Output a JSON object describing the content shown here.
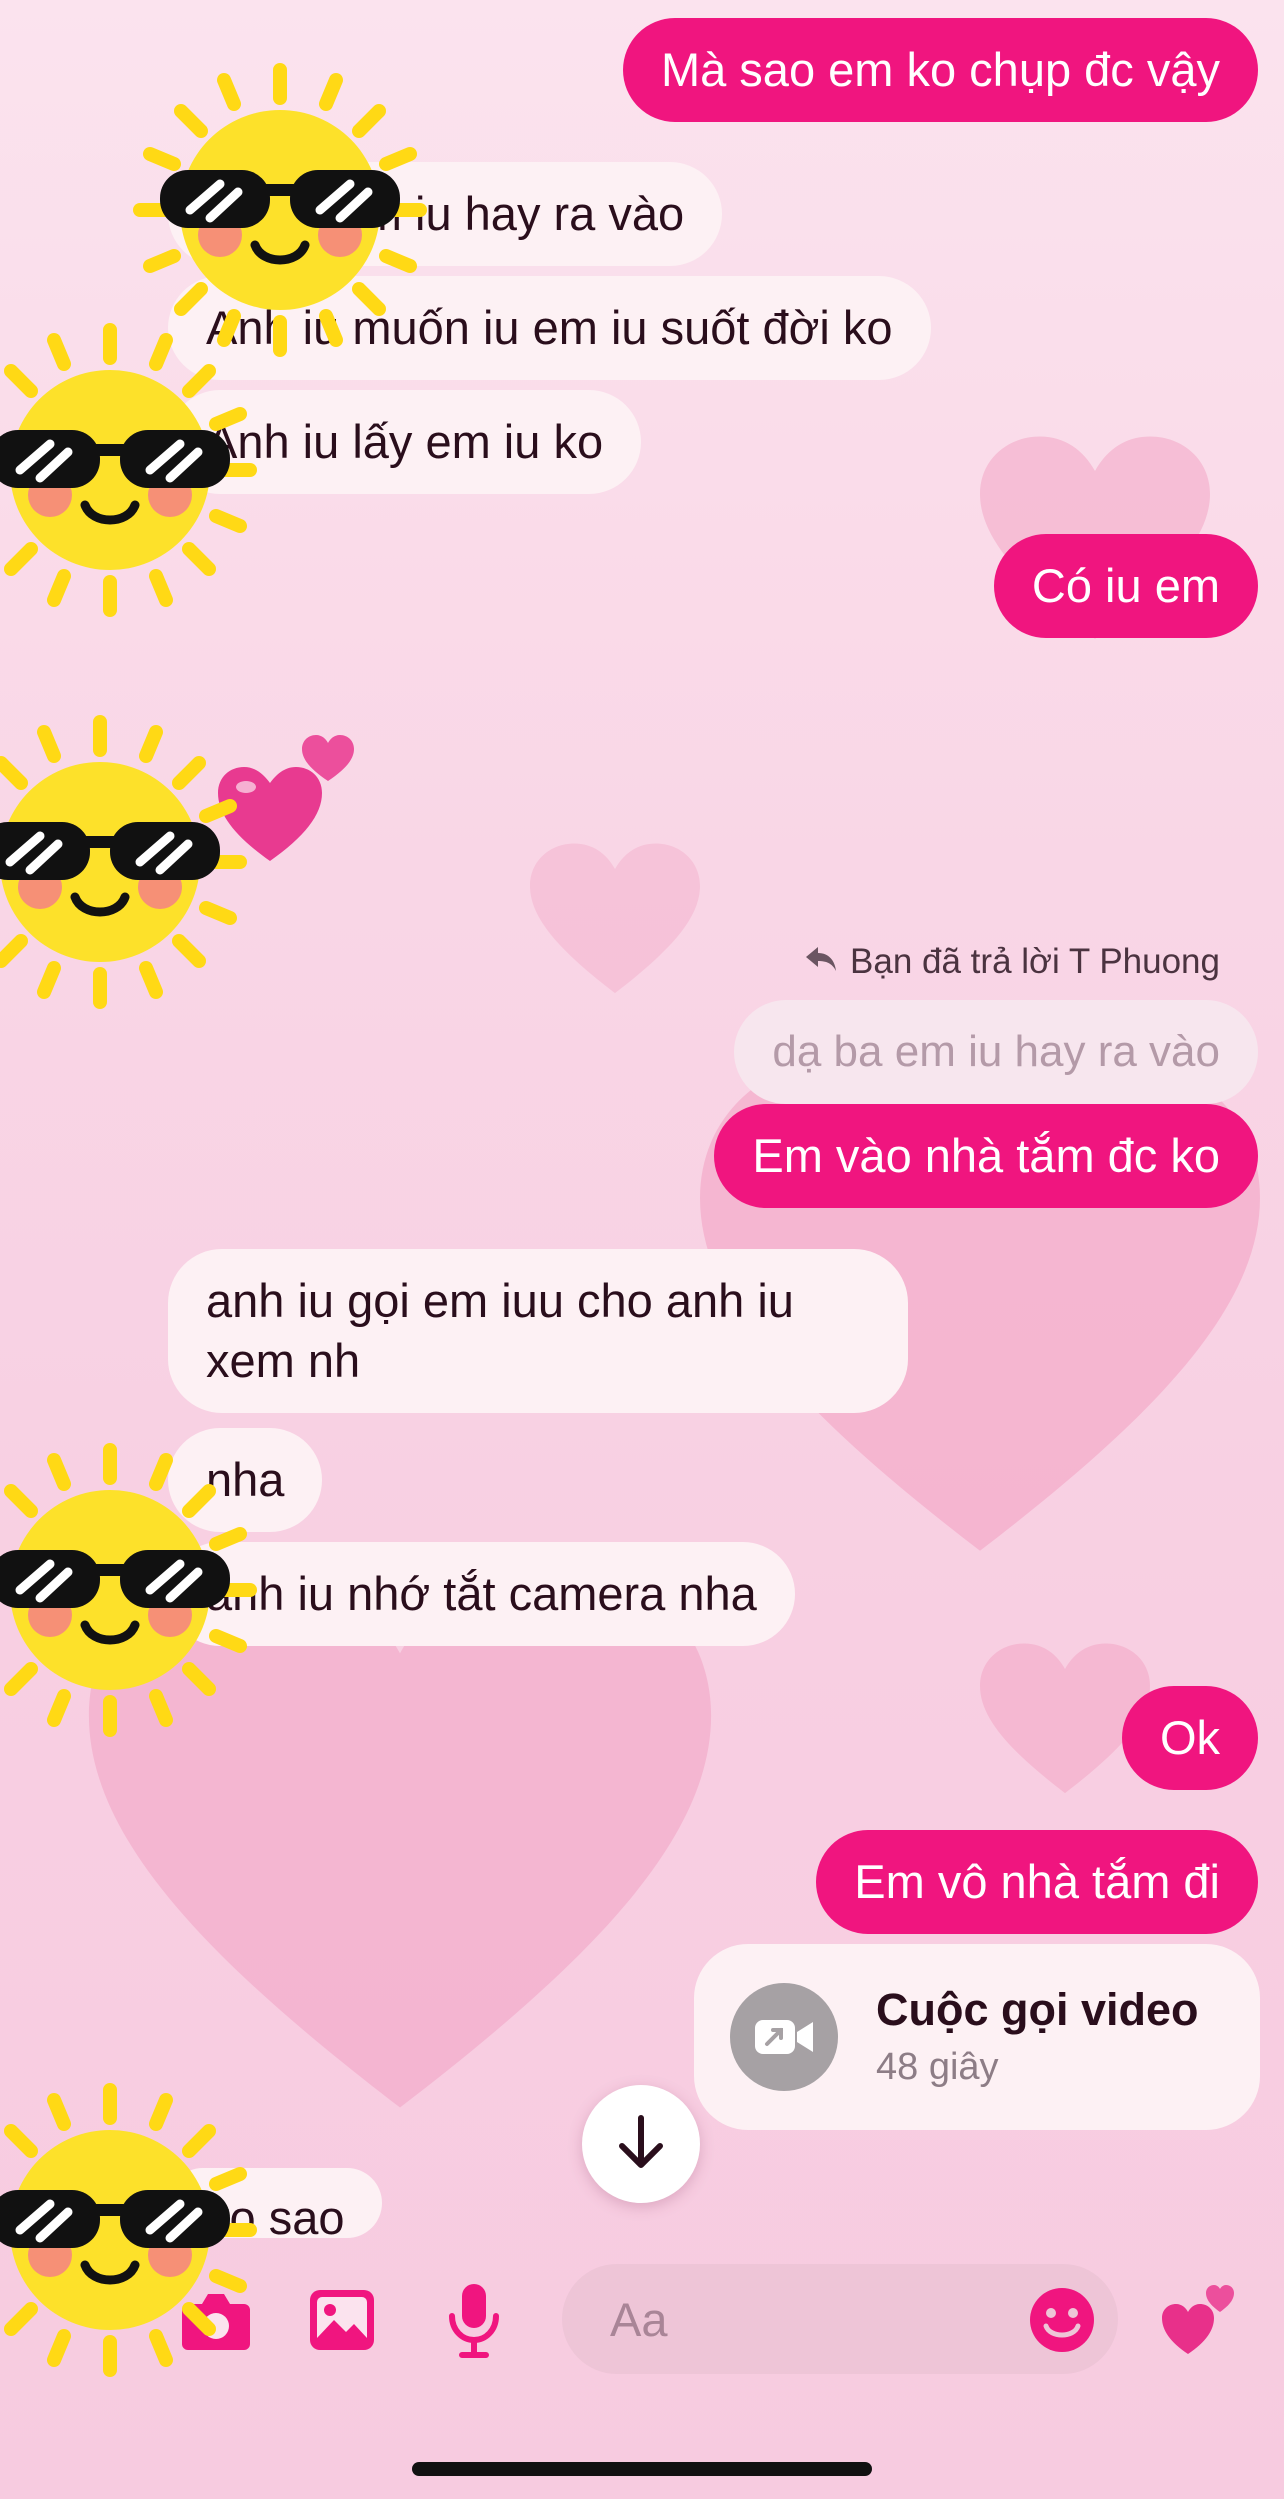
{
  "messages": {
    "out_1": "Mà sao em ko chụp đc vậy",
    "in_1": "dạ ba em iu hay ra vào",
    "in_2": "Anh iu muốn iu em iu suốt đời ko",
    "in_3": "Anh iu lấy em iu ko",
    "out_2": "Có iu em",
    "reply_note": "Bạn đã trả lời T Phuong",
    "quoted": "dạ ba em iu hay ra vào",
    "out_3": "Em vào nhà tắm đc ko",
    "in_4_line1": "anh iu gọi em iuu cho anh iu",
    "in_4_line2": "xem nh",
    "in_5": "nha",
    "in_6": "anh iu nhớ tắt camera nha",
    "out_4": "Ok",
    "out_5": "Em vô nhà tắm đi",
    "in_7": "ko sao"
  },
  "call": {
    "title": "Cuộc gọi video",
    "duration": "48 giây",
    "icon": "video-call-icon"
  },
  "composer": {
    "placeholder": "Aa"
  },
  "colors": {
    "accent": "#f0157f",
    "incoming_bubble": "#fdf1f4",
    "background": "#f9d6e6"
  },
  "icons": [
    "camera-icon",
    "image-icon",
    "microphone-icon",
    "emoji-icon",
    "hearts-icon",
    "arrow-down-icon",
    "reply-arrow-icon"
  ]
}
